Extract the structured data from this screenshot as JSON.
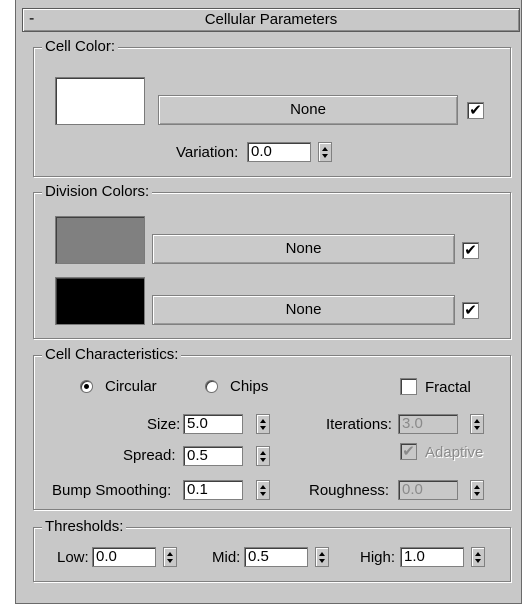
{
  "rollout": {
    "toggle": "-",
    "title": "Cellular Parameters"
  },
  "cell_color": {
    "label": "Cell Color:",
    "swatch_color": "#ffffff",
    "map_button": "None",
    "map_enabled_check": "✔",
    "variation_label": "Variation:",
    "variation_value": "0.0"
  },
  "division_colors": {
    "label": "Division Colors:",
    "swatch1_color": "#808080",
    "swatch2_color": "#000000",
    "map_button1": "None",
    "map_button2": "None",
    "check1": "✔",
    "check2": "✔"
  },
  "cell_characteristics": {
    "label": "Cell Characteristics:",
    "radio_circular": "Circular",
    "radio_chips": "Chips",
    "selected": "Circular",
    "fractal_label": "Fractal",
    "fractal_checked": false,
    "size_label": "Size:",
    "size_value": "5.0",
    "spread_label": "Spread:",
    "spread_value": "0.5",
    "bump_label": "Bump Smoothing:",
    "bump_value": "0.1",
    "iterations_label": "Iterations:",
    "iterations_value": "3.0",
    "adaptive_label": "Adaptive",
    "adaptive_check": "✔",
    "roughness_label": "Roughness:",
    "roughness_value": "0.0"
  },
  "thresholds": {
    "label": "Thresholds:",
    "low_label": "Low:",
    "low_value": "0.0",
    "mid_label": "Mid:",
    "mid_value": "0.5",
    "high_label": "High:",
    "high_value": "1.0"
  }
}
